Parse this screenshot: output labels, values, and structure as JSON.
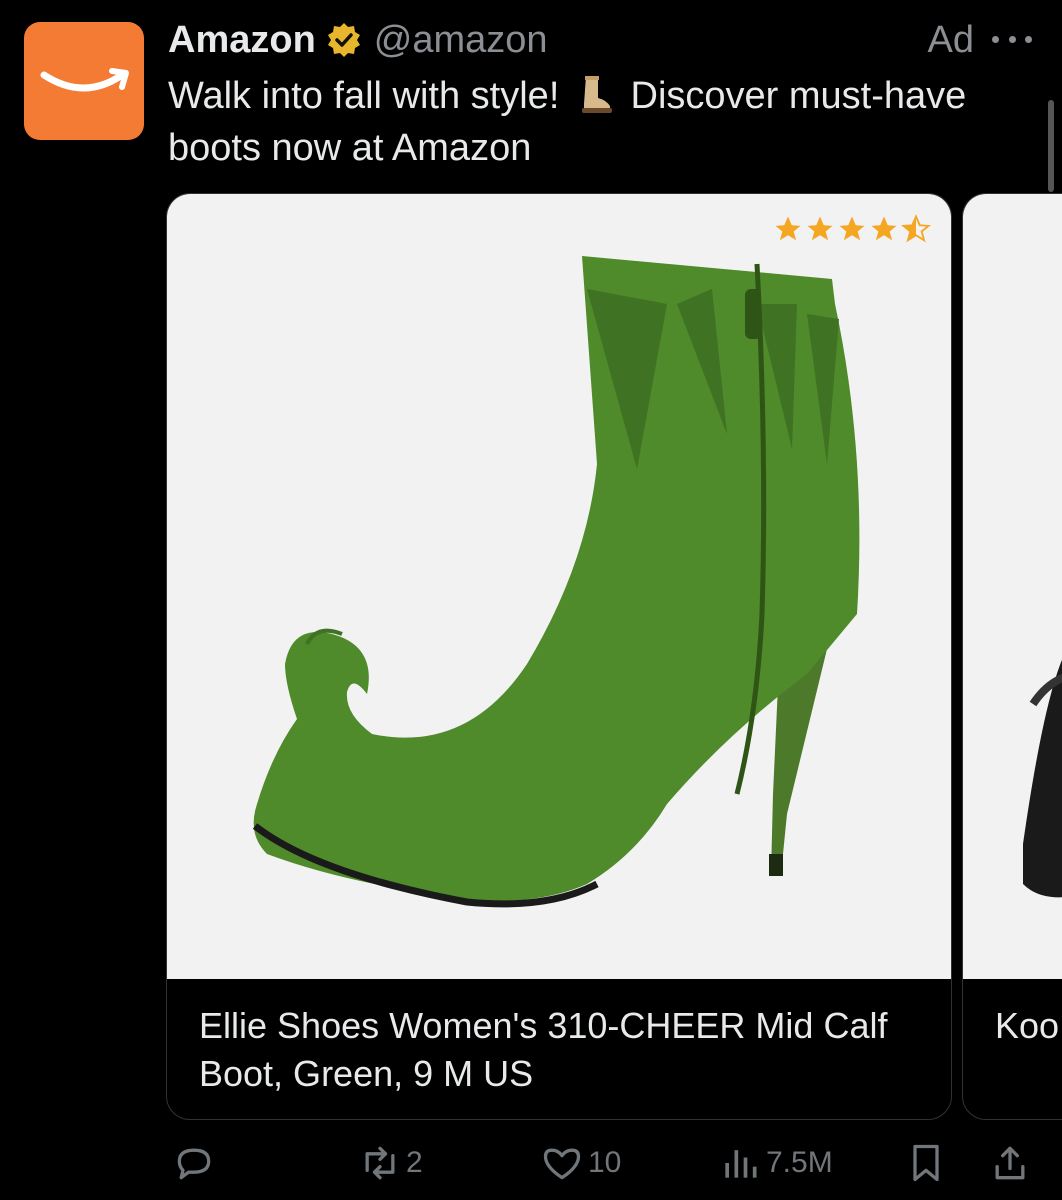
{
  "post": {
    "author_name": "Amazon",
    "handle": "@amazon",
    "ad_label": "Ad",
    "text_part1": "Walk into fall with style!",
    "text_part2": "Discover must-have boots now at Amazon",
    "avatar_color": "#f47b33",
    "verified_badge_color": "#e8b62d"
  },
  "carousel": [
    {
      "title": "Ellie Shoes Women's 310-CHEER Mid Calf Boot, Green, 9 M US",
      "rating": 4.5,
      "rating_max": 5,
      "star_color": "#f5a623"
    },
    {
      "title": "Koo Slip"
    }
  ],
  "actions": {
    "reply_count": "",
    "repost_count": "2",
    "like_count": "10",
    "views_count": "7.5M"
  }
}
